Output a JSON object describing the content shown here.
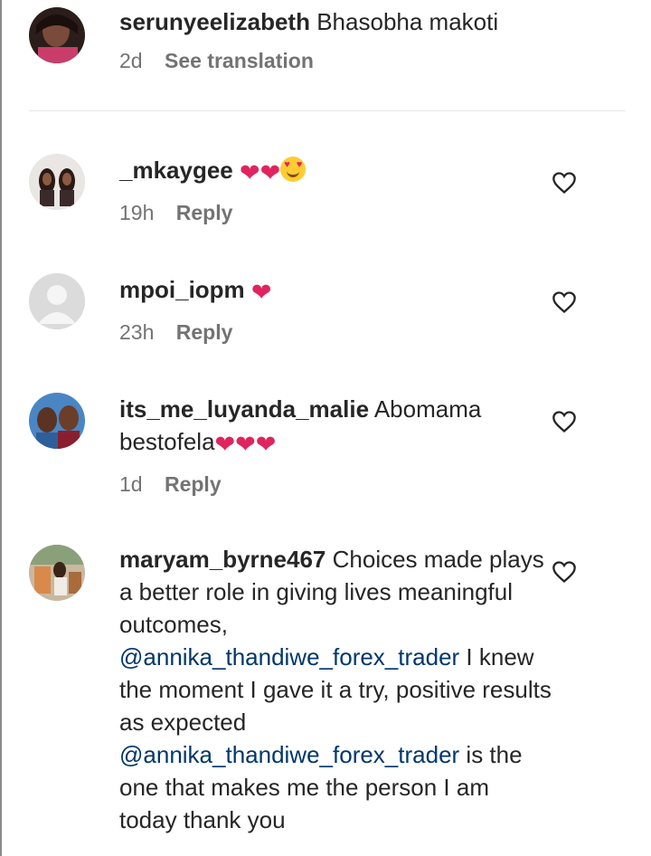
{
  "comments": [
    {
      "user": "serunyeelizabeth",
      "text": "Bhasobha makoti",
      "time": "2d",
      "action": "See translation"
    },
    {
      "user": "_mkaygee",
      "text": "",
      "emojis": [
        "red-heart",
        "red-heart",
        "heart-eyes"
      ],
      "time": "19h",
      "action": "Reply"
    },
    {
      "user": "mpoi_iopm",
      "text": "",
      "emojis": [
        "red-heart"
      ],
      "time": "23h",
      "action": "Reply"
    },
    {
      "user": "its_me_luyanda_malie",
      "text": "Abomama bestofela",
      "emojis": [
        "red-heart",
        "red-heart",
        "red-heart"
      ],
      "time": "1d",
      "action": "Reply"
    },
    {
      "user": "maryam_byrne467",
      "text_parts": [
        "Choices made plays a better role in giving lives meaningful outcomes,",
        "@annika_thandiwe_forex_trader",
        "I knew the moment I gave it a try, positive results as expected",
        "@annika_thandiwe_forex_trader",
        "is the one that makes me the person I am today thank you"
      ]
    }
  ],
  "colors": {
    "mention": "#00376b",
    "meta": "#737373",
    "heart": "#e0245e"
  },
  "icons": {
    "like": "heart-outline-icon"
  }
}
